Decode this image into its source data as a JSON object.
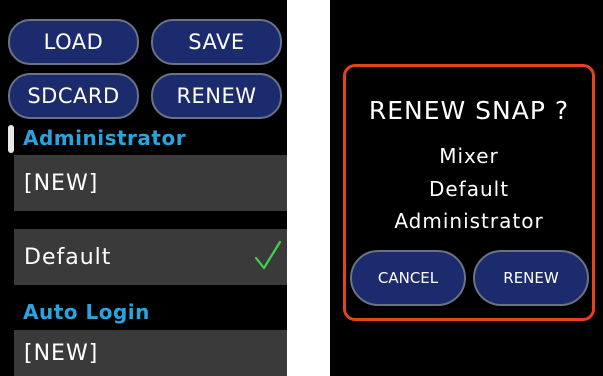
{
  "left_panel": {
    "buttons": {
      "load": "LOAD",
      "save": "SAVE",
      "sdcard": "SDCARD",
      "renew": "RENEW"
    },
    "section_administrator": "Administrator",
    "rows": [
      {
        "label": "[NEW]",
        "selected": false
      },
      {
        "label": "Default",
        "selected": true
      }
    ],
    "section_auto_login": "Auto Login",
    "auto_login_row": {
      "label": "[NEW]"
    },
    "icons": {
      "selected_marker": "checkmark-icon"
    },
    "colors": {
      "accent": "#2aa3e0",
      "check": "#3fd44a",
      "button_fill": "#1c2a6e",
      "row_bg": "#3a3a3a"
    }
  },
  "dialog": {
    "title": "RENEW SNAP ?",
    "lines": [
      "Mixer",
      "Default",
      "Administrator"
    ],
    "cancel_label": "CANCEL",
    "confirm_label": "RENEW",
    "colors": {
      "border": "#e2431f"
    }
  }
}
